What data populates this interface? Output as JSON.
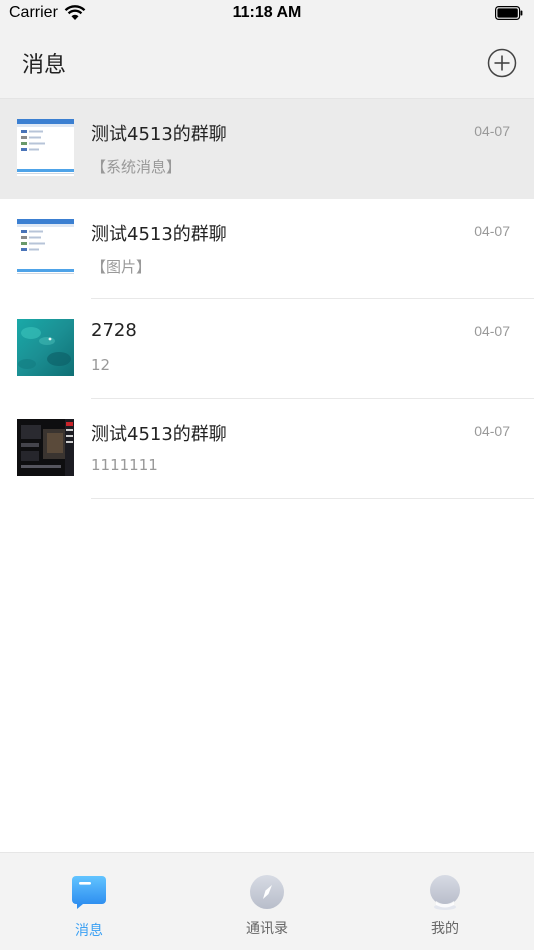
{
  "status_bar": {
    "carrier": "Carrier",
    "time": "11:18 AM"
  },
  "header": {
    "title": "消息",
    "add_icon": "plus-circle-icon"
  },
  "conversations": [
    {
      "name": "测试4513的群聊",
      "date": "04-07",
      "preview": "【系统消息】",
      "avatar": "screenshot-thumbnail",
      "selected": true
    },
    {
      "name": "测试4513的群聊",
      "date": "04-07",
      "preview": "【图片】",
      "avatar": "screenshot-thumbnail",
      "selected": false
    },
    {
      "name": "2728",
      "date": "04-07",
      "preview": "12",
      "avatar": "ocean-photo-thumbnail",
      "selected": false
    },
    {
      "name": "测试4513的群聊",
      "date": "04-07",
      "preview": "1111111",
      "avatar": "dark-screenshot-thumbnail",
      "selected": false
    }
  ],
  "tab_bar": {
    "tabs": [
      {
        "label": "消息",
        "icon": "message-icon",
        "active": true
      },
      {
        "label": "通讯录",
        "icon": "compass-icon",
        "active": false
      },
      {
        "label": "我的",
        "icon": "profile-icon",
        "active": false
      }
    ]
  },
  "colors": {
    "accent": "#3ba0f3",
    "header_bg": "#f2f2f2",
    "selected_row_bg": "#ebebeb"
  }
}
